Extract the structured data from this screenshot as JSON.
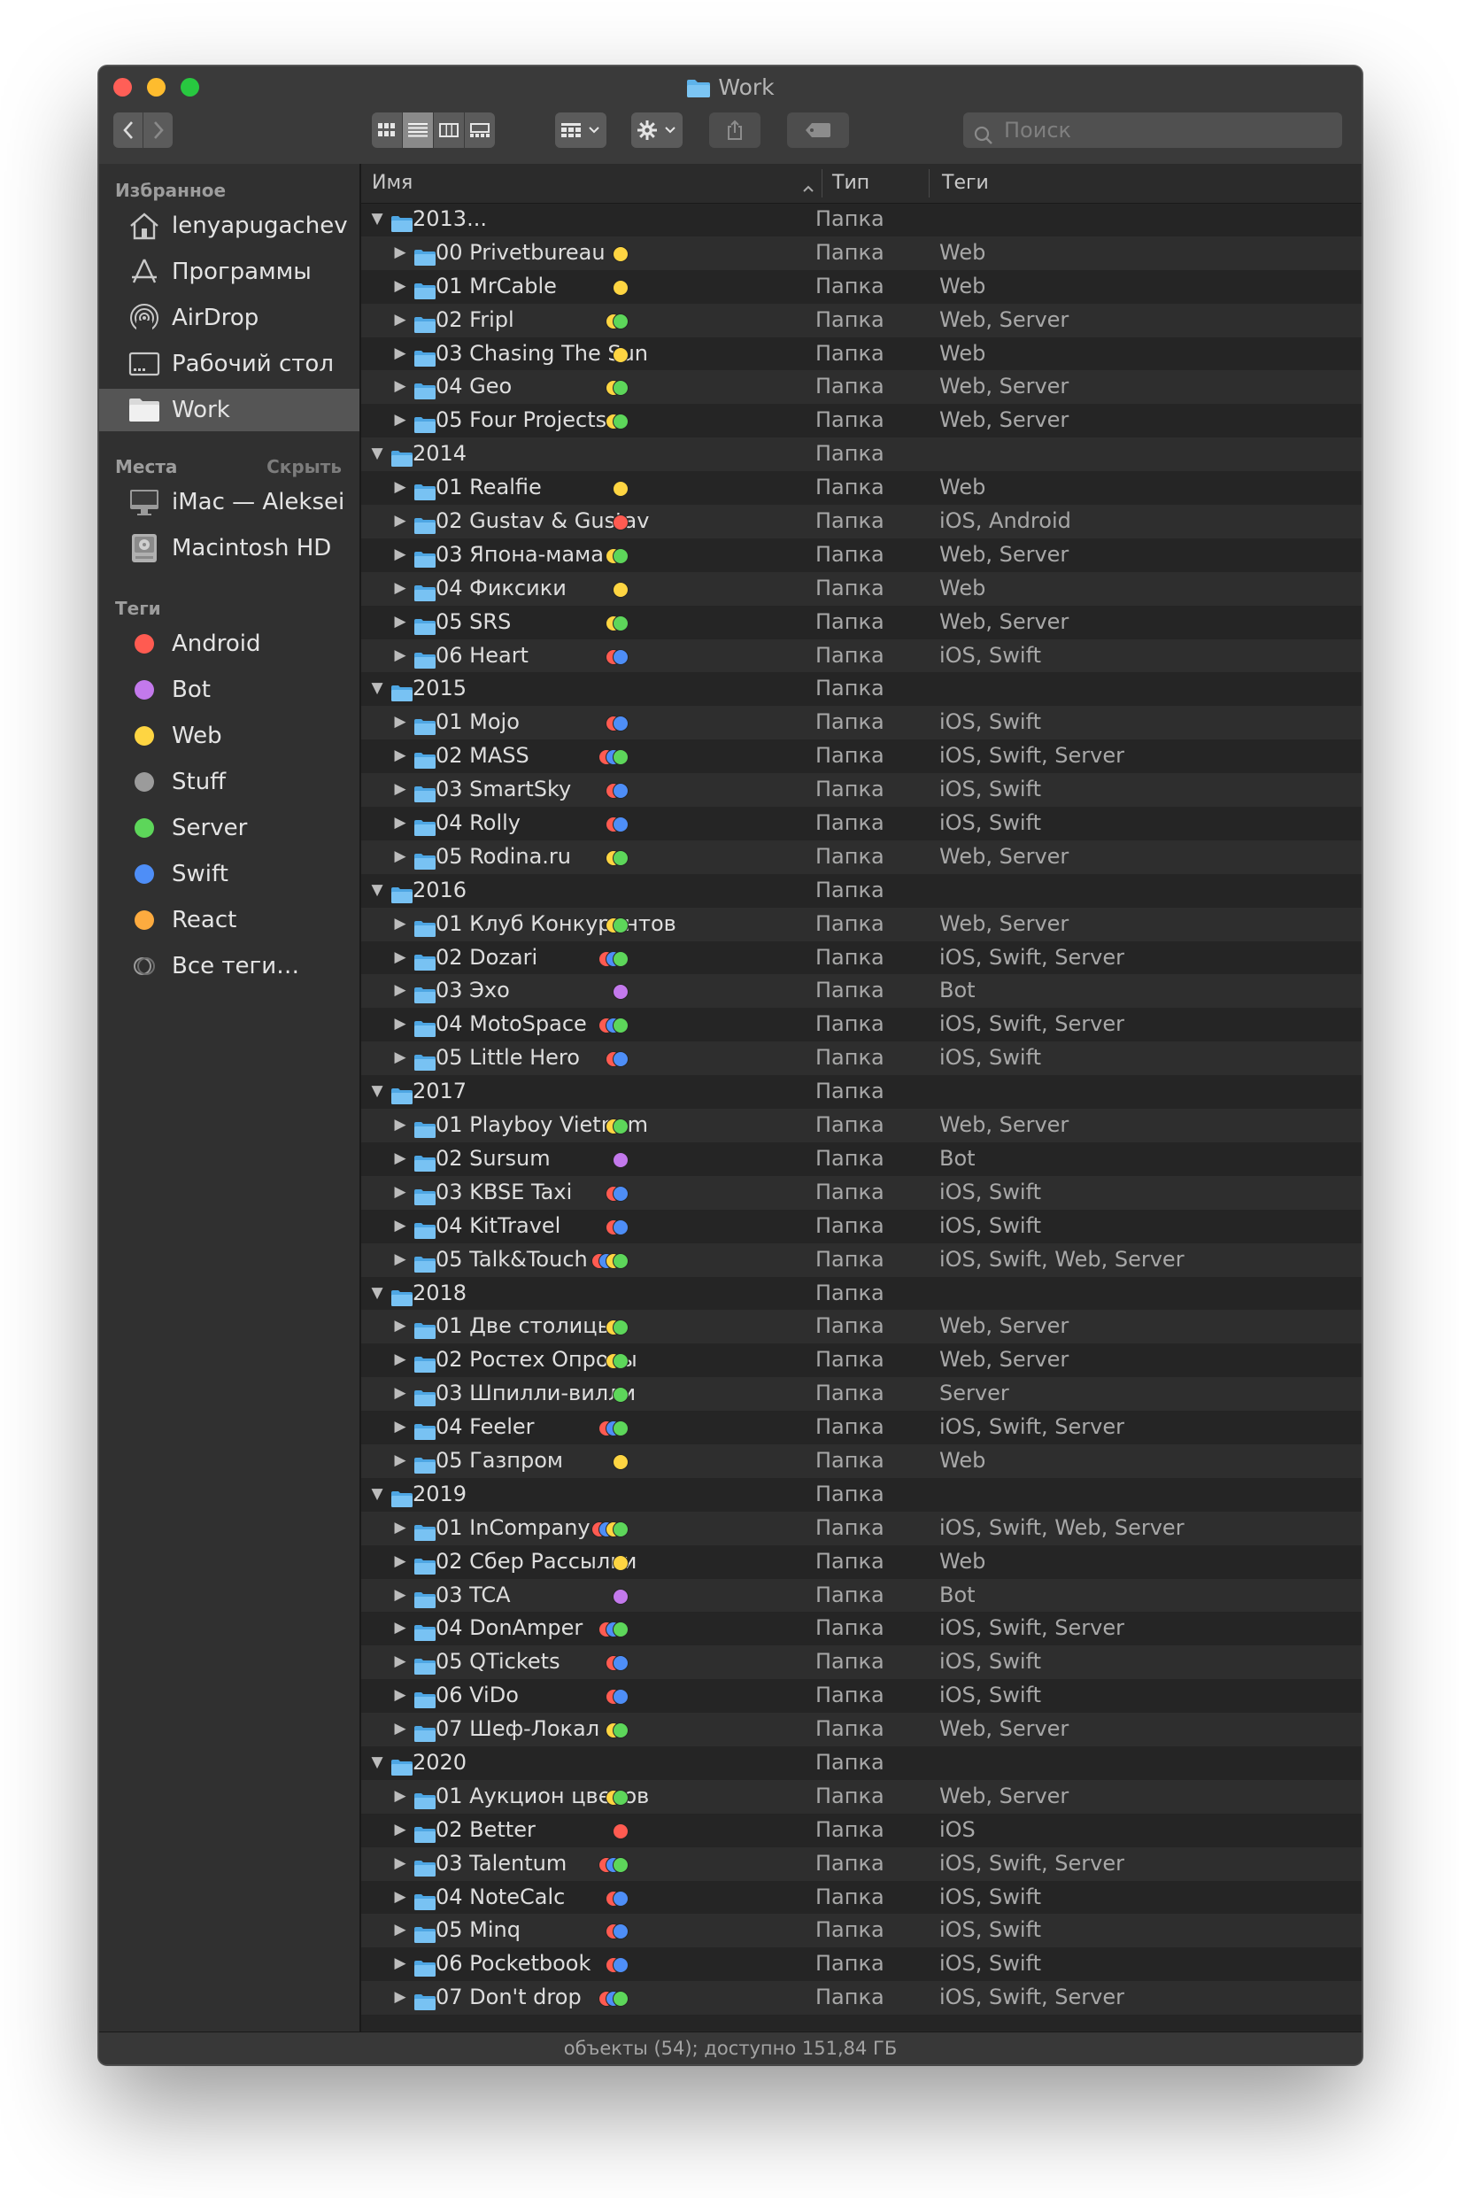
{
  "window": {
    "title": "Work"
  },
  "toolbar": {
    "view_modes": [
      "icon-view",
      "list-view",
      "column-view",
      "gallery-view"
    ],
    "active_view": "list-view",
    "search_placeholder": "Поиск"
  },
  "sidebar": {
    "favorites_title": "Избранное",
    "favorites": [
      {
        "label": "lenyapugachev",
        "icon": "home-icon",
        "selected": false
      },
      {
        "label": "Программы",
        "icon": "applications-icon",
        "selected": false
      },
      {
        "label": "AirDrop",
        "icon": "airdrop-icon",
        "selected": false
      },
      {
        "label": "Рабочий стол",
        "icon": "desktop-icon",
        "selected": false
      },
      {
        "label": "Work",
        "icon": "folder-icon",
        "selected": true
      }
    ],
    "locations_title": "Места",
    "locations_hide": "Скрыть",
    "locations": [
      {
        "label": "iMac — Aleksei",
        "icon": "imac-icon"
      },
      {
        "label": "Macintosh HD",
        "icon": "disk-icon"
      }
    ],
    "tags_title": "Теги",
    "tags": [
      {
        "label": "Android",
        "color": "#ff5b51"
      },
      {
        "label": "Bot",
        "color": "#c379ec"
      },
      {
        "label": "Web",
        "color": "#fed542"
      },
      {
        "label": "Stuff",
        "color": "#9b9b9b"
      },
      {
        "label": "Server",
        "color": "#5dd65a"
      },
      {
        "label": "Swift",
        "color": "#4e8ef7"
      },
      {
        "label": "React",
        "color": "#fdab3f"
      },
      {
        "label": "Все теги…",
        "color": ""
      }
    ]
  },
  "tag_colors": {
    "Web": "#fed542",
    "Server": "#5dd65a",
    "iOS": "#ff5b51",
    "Android": "#ff5b51",
    "Swift": "#4e8ef7",
    "Bot": "#c379ec"
  },
  "columns": {
    "name": "Имя",
    "kind": "Тип",
    "tags": "Теги"
  },
  "groups": [
    {
      "name": "2013...",
      "kind": "Папка",
      "items": [
        {
          "name": "00 Privetbureau",
          "kind": "Папка",
          "tags": "Web"
        },
        {
          "name": "01 MrCable",
          "kind": "Папка",
          "tags": "Web"
        },
        {
          "name": "02 Fripl",
          "kind": "Папка",
          "tags": "Web, Server"
        },
        {
          "name": "03 Chasing The Sun",
          "kind": "Папка",
          "tags": "Web"
        },
        {
          "name": "04 Geo",
          "kind": "Папка",
          "tags": "Web, Server"
        },
        {
          "name": "05 Four Projects",
          "kind": "Папка",
          "tags": "Web, Server"
        }
      ]
    },
    {
      "name": "2014",
      "kind": "Папка",
      "items": [
        {
          "name": "01 Realfie",
          "kind": "Папка",
          "tags": "Web"
        },
        {
          "name": "02 Gustav & Gustav",
          "kind": "Папка",
          "tags": "iOS, Android"
        },
        {
          "name": "03 Япона-мама",
          "kind": "Папка",
          "tags": "Web, Server"
        },
        {
          "name": "04 Фиксики",
          "kind": "Папка",
          "tags": "Web"
        },
        {
          "name": "05 SRS",
          "kind": "Папка",
          "tags": "Web, Server"
        },
        {
          "name": "06 Heart",
          "kind": "Папка",
          "tags": "iOS, Swift"
        }
      ]
    },
    {
      "name": "2015",
      "kind": "Папка",
      "items": [
        {
          "name": "01 Mojo",
          "kind": "Папка",
          "tags": "iOS, Swift"
        },
        {
          "name": "02 MASS",
          "kind": "Папка",
          "tags": "iOS, Swift, Server"
        },
        {
          "name": "03 SmartSky",
          "kind": "Папка",
          "tags": "iOS, Swift"
        },
        {
          "name": "04 Rolly",
          "kind": "Папка",
          "tags": "iOS, Swift"
        },
        {
          "name": "05 Rodina.ru",
          "kind": "Папка",
          "tags": "Web, Server"
        }
      ]
    },
    {
      "name": "2016",
      "kind": "Папка",
      "items": [
        {
          "name": "01 Клуб Конкурентов",
          "kind": "Папка",
          "tags": "Web, Server"
        },
        {
          "name": "02 Dozari",
          "kind": "Папка",
          "tags": "iOS, Swift, Server"
        },
        {
          "name": "03 Эхо",
          "kind": "Папка",
          "tags": "Bot"
        },
        {
          "name": "04 MotoSpace",
          "kind": "Папка",
          "tags": "iOS, Swift, Server"
        },
        {
          "name": "05 Little Hero",
          "kind": "Папка",
          "tags": "iOS, Swift"
        }
      ]
    },
    {
      "name": "2017",
      "kind": "Папка",
      "items": [
        {
          "name": "01 Playboy Vietnam",
          "kind": "Папка",
          "tags": "Web, Server"
        },
        {
          "name": "02 Sursum",
          "kind": "Папка",
          "tags": "Bot"
        },
        {
          "name": "03 KBSE Taxi",
          "kind": "Папка",
          "tags": "iOS, Swift"
        },
        {
          "name": "04 KitTravel",
          "kind": "Папка",
          "tags": "iOS, Swift"
        },
        {
          "name": "05 Talk&Touch",
          "kind": "Папка",
          "tags": "iOS, Swift, Web, Server"
        }
      ]
    },
    {
      "name": "2018",
      "kind": "Папка",
      "items": [
        {
          "name": "01 Две столицы",
          "kind": "Папка",
          "tags": "Web, Server"
        },
        {
          "name": "02 Ростех Опросы",
          "kind": "Папка",
          "tags": "Web, Server"
        },
        {
          "name": "03 Шпилли-вилли",
          "kind": "Папка",
          "tags": "Server"
        },
        {
          "name": "04 Feeler",
          "kind": "Папка",
          "tags": "iOS, Swift, Server"
        },
        {
          "name": "05 Газпром",
          "kind": "Папка",
          "tags": "Web"
        }
      ]
    },
    {
      "name": "2019",
      "kind": "Папка",
      "items": [
        {
          "name": "01 InCompany",
          "kind": "Папка",
          "tags": "iOS, Swift, Web, Server"
        },
        {
          "name": "02 Сбер Рассылки",
          "kind": "Папка",
          "tags": "Web"
        },
        {
          "name": "03 TCA",
          "kind": "Папка",
          "tags": "Bot"
        },
        {
          "name": "04 DonAmper",
          "kind": "Папка",
          "tags": "iOS, Swift, Server"
        },
        {
          "name": "05 QTickets",
          "kind": "Папка",
          "tags": "iOS, Swift"
        },
        {
          "name": "06 ViDo",
          "kind": "Папка",
          "tags": "iOS, Swift"
        },
        {
          "name": "07 Шеф-Локал",
          "kind": "Папка",
          "tags": "Web, Server"
        }
      ]
    },
    {
      "name": "2020",
      "kind": "Папка",
      "items": [
        {
          "name": "01 Аукцион цветов",
          "kind": "Папка",
          "tags": "Web, Server"
        },
        {
          "name": "02 Better",
          "kind": "Папка",
          "tags": "iOS"
        },
        {
          "name": "03 Talentum",
          "kind": "Папка",
          "tags": "iOS, Swift, Server"
        },
        {
          "name": "04 NoteCalc",
          "kind": "Папка",
          "tags": "iOS, Swift"
        },
        {
          "name": "05 Minq",
          "kind": "Папка",
          "tags": "iOS, Swift"
        },
        {
          "name": "06 Pocketbook",
          "kind": "Папка",
          "tags": "iOS, Swift"
        },
        {
          "name": "07 Don't drop",
          "kind": "Папка",
          "tags": "iOS, Swift, Server"
        }
      ]
    }
  ],
  "status": "объекты (54); доступно 151,84 ГБ"
}
